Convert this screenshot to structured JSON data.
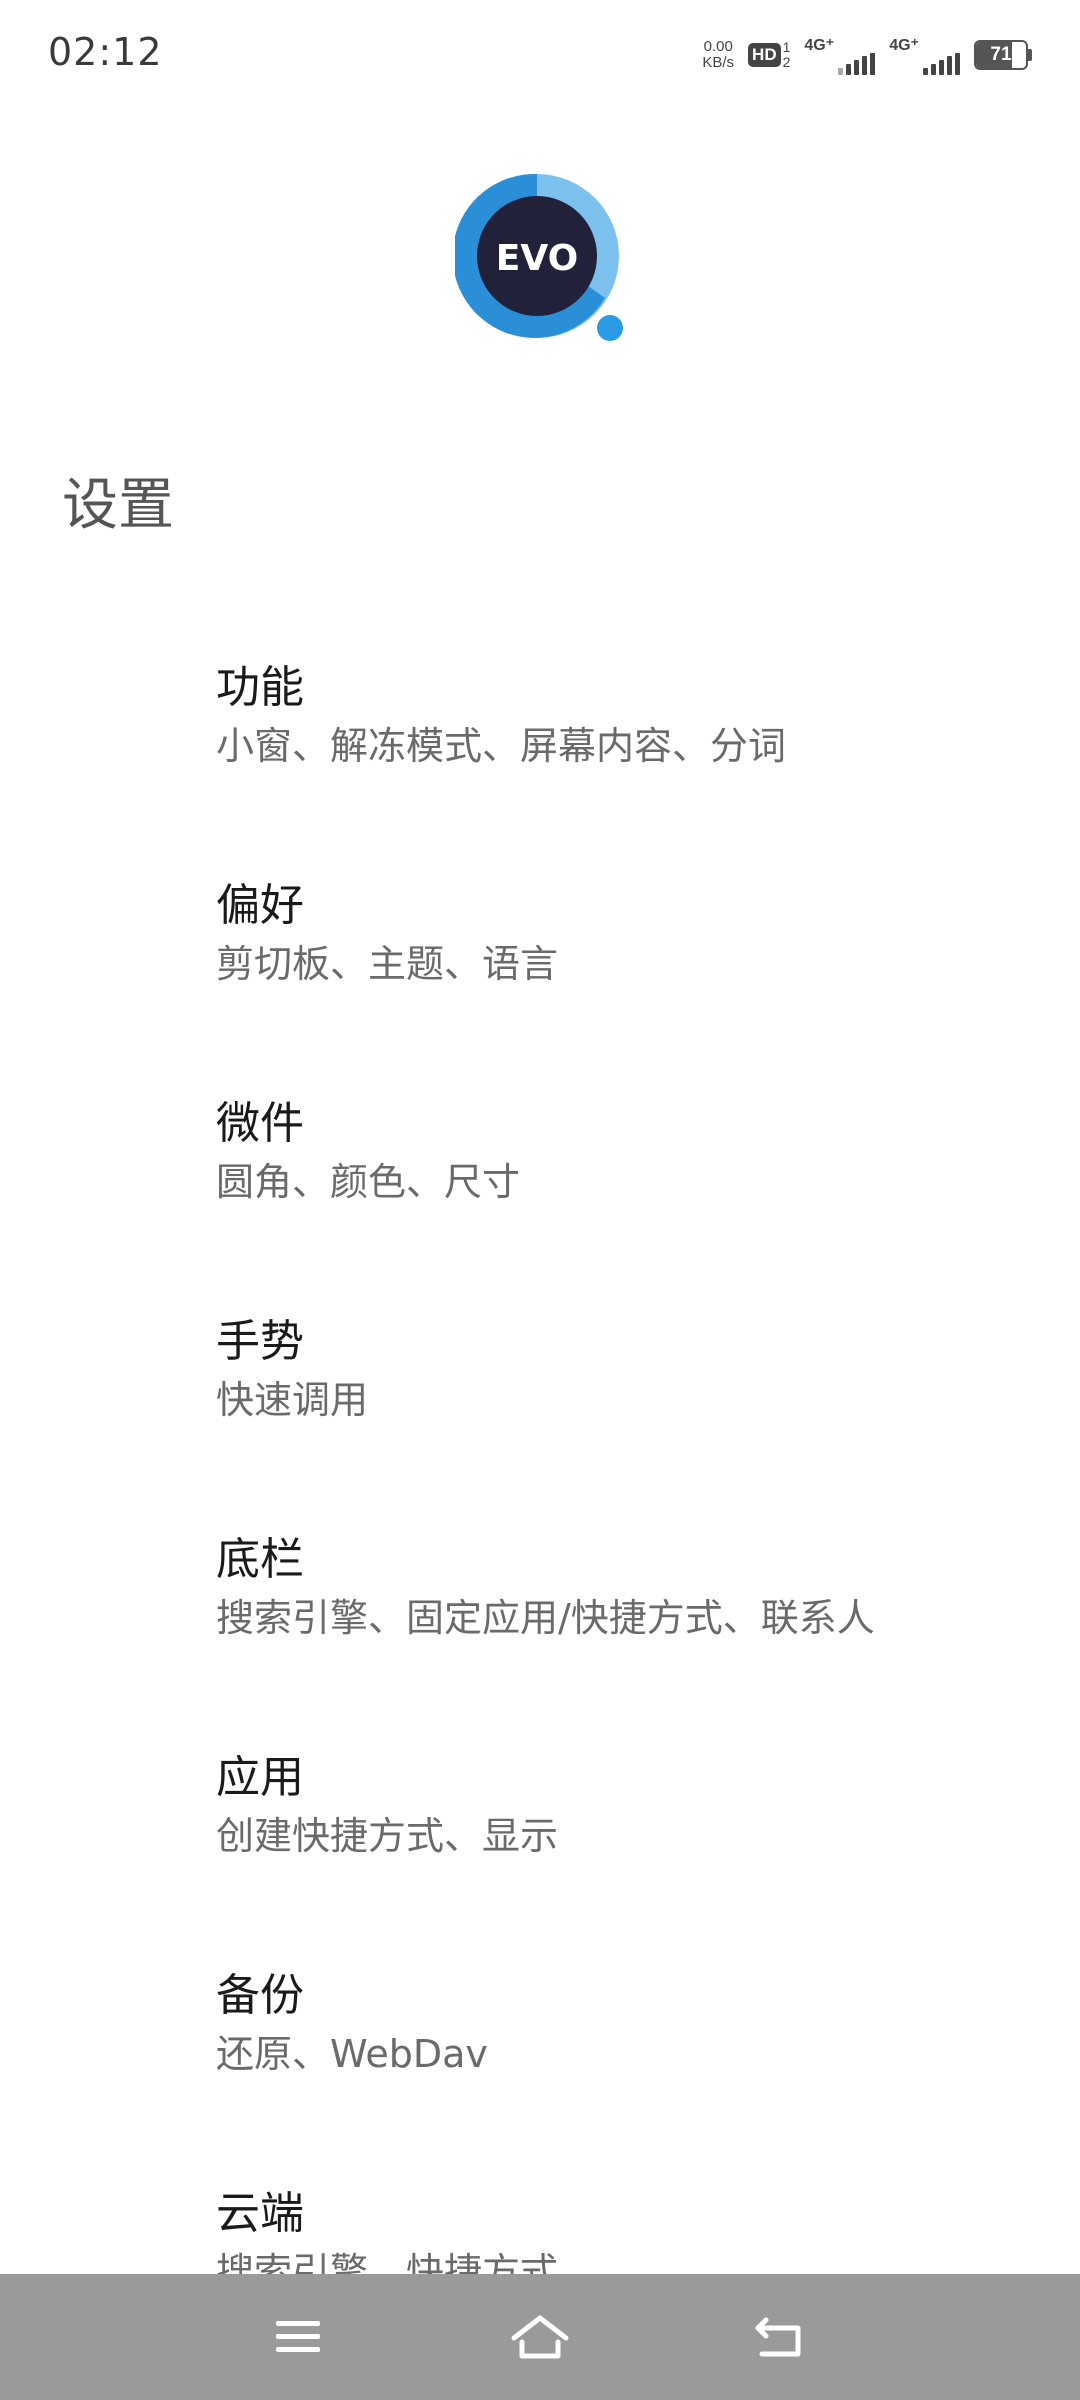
{
  "status_bar": {
    "time": "02:12",
    "net_speed_value": "0.00",
    "net_speed_unit": "KB/s",
    "hd_label": "HD",
    "hd_sim_top": "1",
    "hd_sim_bottom": "2",
    "sim1_label": "4G⁺",
    "sim2_label": "4G⁺",
    "battery_level": "71",
    "battery_percent": 71
  },
  "app": {
    "logo_text": "EVO",
    "logo_colors": {
      "ring_light": "#7cc0ee",
      "ring_dark": "#2b8fd8",
      "center": "#22213a",
      "dot": "#2b9be6"
    }
  },
  "page": {
    "title": "设置"
  },
  "settings": {
    "items": [
      {
        "title": "功能",
        "subtitle": "小窗、解冻模式、屏幕内容、分词"
      },
      {
        "title": "偏好",
        "subtitle": "剪切板、主题、语言"
      },
      {
        "title": "微件",
        "subtitle": "圆角、颜色、尺寸"
      },
      {
        "title": "手势",
        "subtitle": "快速调用"
      },
      {
        "title": "底栏",
        "subtitle": "搜索引擎、固定应用/快捷方式、联系人"
      },
      {
        "title": "应用",
        "subtitle": "创建快捷方式、显示"
      },
      {
        "title": "备份",
        "subtitle": "还原、WebDav"
      },
      {
        "title": "云端",
        "subtitle": "搜索引擎、快捷方式"
      }
    ]
  },
  "nav_bar": {
    "background": "#9a9a9a",
    "icons": [
      "menu-icon",
      "home-icon",
      "back-icon"
    ]
  }
}
